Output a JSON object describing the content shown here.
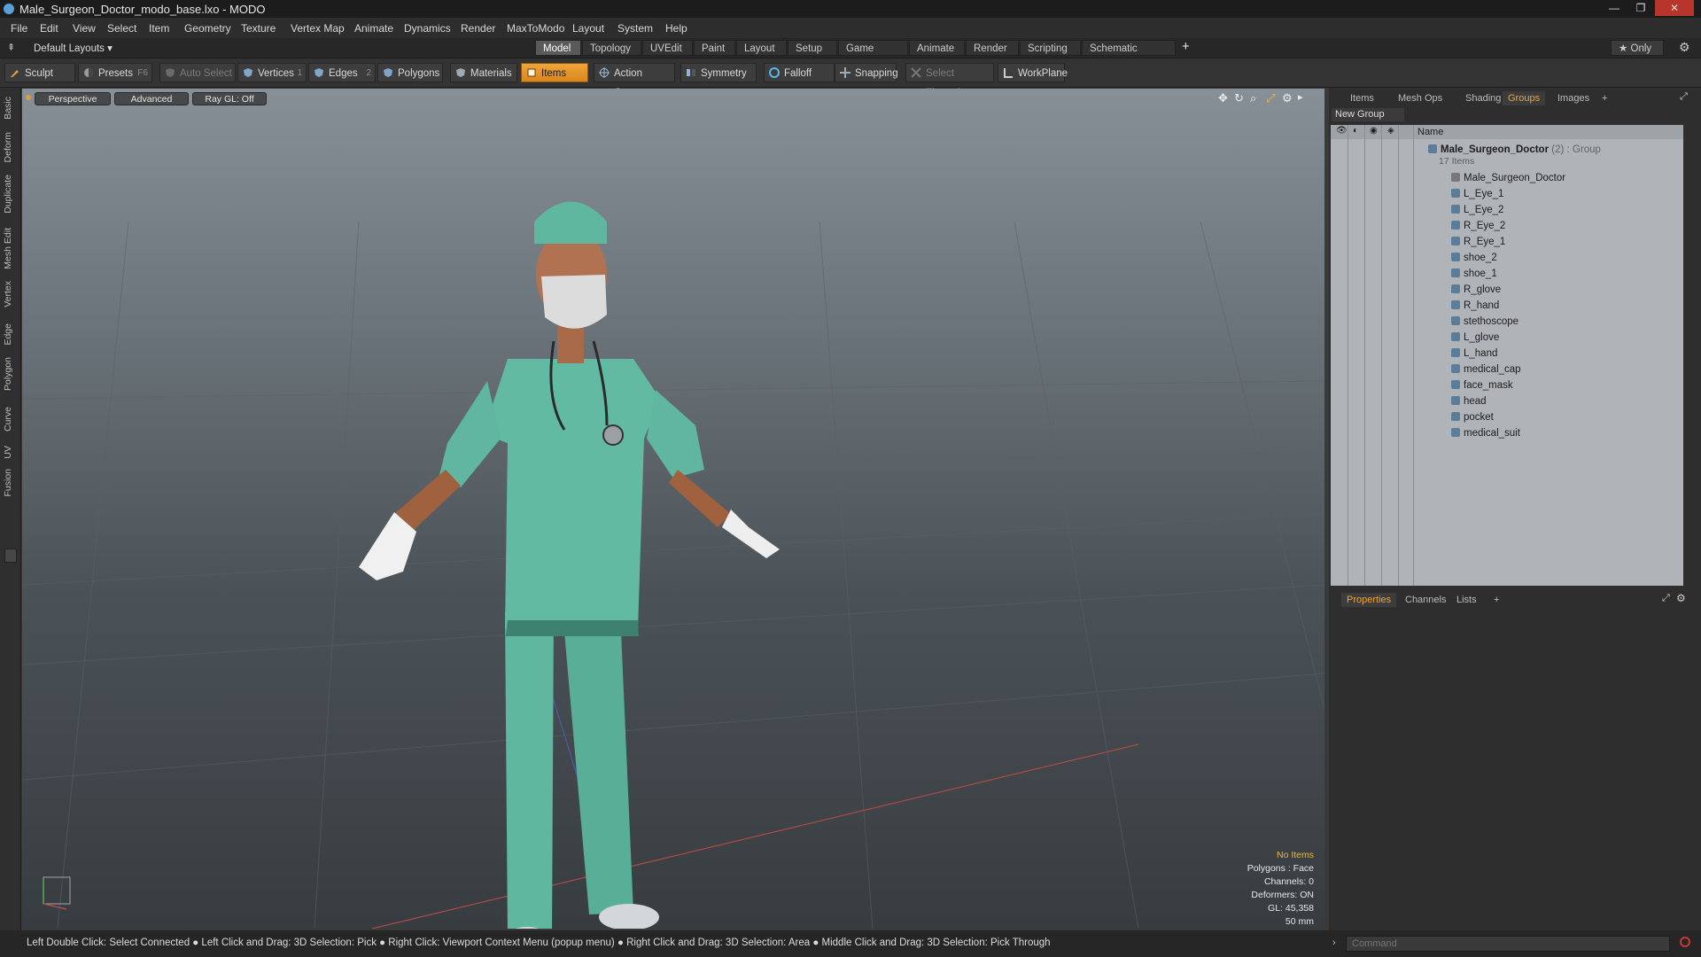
{
  "window": {
    "title": "Male_Surgeon_Doctor_modo_base.lxo - MODO",
    "controls": {
      "minimize": "—",
      "maximize": "❐",
      "close": "✕"
    }
  },
  "menu": [
    "File",
    "Edit",
    "View",
    "Select",
    "Item",
    "Geometry",
    "Texture",
    "Vertex Map",
    "Animate",
    "Dynamics",
    "Render",
    "MaxToModo",
    "Layout",
    "System",
    "Help"
  ],
  "layout": {
    "selector": "Default Layouts ▾",
    "tabs": [
      "Model",
      "Topology",
      "UVEdit",
      "Paint",
      "Layout",
      "Setup",
      "Game Tools",
      "Animate",
      "Render",
      "Scripting",
      "Schematic Fusion"
    ],
    "active_tab": "Model",
    "add_label": "+",
    "only_label": "★ Only"
  },
  "toolbar": {
    "sculpt": "Sculpt",
    "presets": "Presets",
    "presets_key": "F6",
    "auto_select": "Auto Select",
    "vertices": "Vertices",
    "vertices_count": "1",
    "edges": "Edges",
    "edges_count": "2",
    "polygons": "Polygons",
    "materials": "Materials",
    "items": "Items",
    "action_center": "Action Center",
    "symmetry": "Symmetry",
    "falloff": "Falloff",
    "snapping": "Snapping",
    "select_through": "Select Through",
    "workplane": "WorkPlane"
  },
  "left_tabs": [
    "Basic",
    "Deform",
    "Duplicate",
    "Mesh Edit",
    "Vertex",
    "Edge",
    "Polygon",
    "Curve",
    "UV",
    "Fusion"
  ],
  "viewport": {
    "view_mode": "Perspective",
    "shading": "Advanced",
    "raygl": "Ray GL: Off",
    "info": {
      "selection": "No Items",
      "polygons": "Polygons : Face",
      "channels": "Channels: 0",
      "deformers": "Deformers: ON",
      "gl": "GL: 45,358",
      "lens": "50 mm"
    }
  },
  "right_panel": {
    "tabs": [
      "Items",
      "Mesh Ops",
      "Shading",
      "Groups",
      "Images"
    ],
    "active_tab": "Groups",
    "add_tab": "+",
    "new_group": "New Group",
    "column_name": "Name",
    "group": {
      "name": "Male_Surgeon_Doctor",
      "count": "(2)",
      "type": ": Group",
      "items_label": "17 Items"
    },
    "items": [
      "Male_Surgeon_Doctor",
      "L_Eye_1",
      "L_Eye_2",
      "R_Eye_2",
      "R_Eye_1",
      "shoe_2",
      "shoe_1",
      "R_glove",
      "R_hand",
      "stethoscope",
      "L_glove",
      "L_hand",
      "medical_cap",
      "face_mask",
      "head",
      "pocket",
      "medical_suit"
    ],
    "bottom_tabs": [
      "Properties",
      "Channels",
      "Lists"
    ],
    "bottom_active": "Properties"
  },
  "status": {
    "hint": "Left Double Click: Select Connected ● Left Click and Drag: 3D Selection: Pick ● Right Click: Viewport Context Menu (popup menu) ● Right Click and Drag: 3D Selection: Area ● Middle Click and Drag: 3D Selection: Pick Through"
  },
  "command": {
    "placeholder": "Command"
  },
  "colors": {
    "accent": "#f0a53a",
    "scrubs": "#5fb7a0",
    "viewport_top": "#869096",
    "viewport_bottom": "#373c40"
  }
}
